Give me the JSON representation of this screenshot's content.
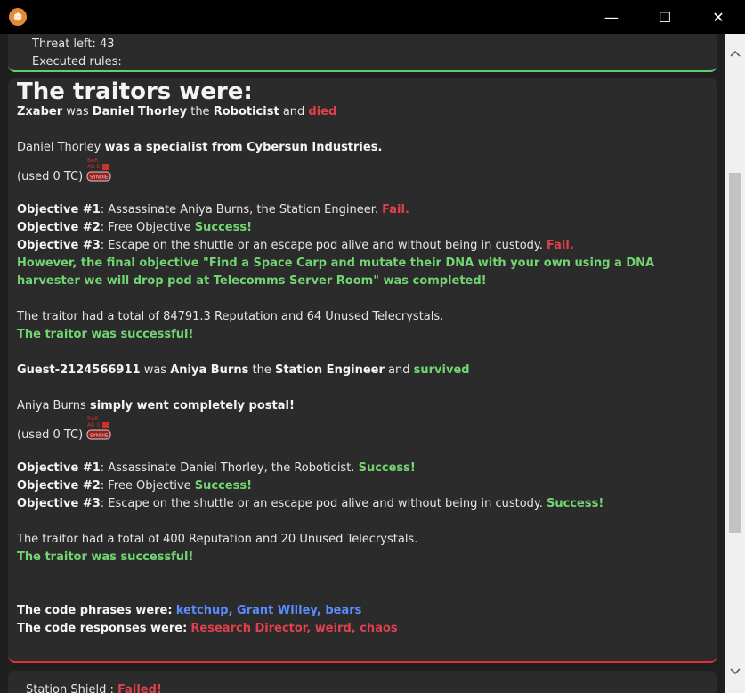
{
  "window": {
    "icon": "app-icon",
    "minimize": "—",
    "maximize": "☐",
    "close": "✕"
  },
  "top_panel": {
    "threat_left": "Threat left: 43",
    "executed_rules": "Executed rules:"
  },
  "heading": "The traitors were:",
  "traitors": [
    {
      "player": "Zxaber",
      "was": "was",
      "name": "Daniel Thorley",
      "the": "the",
      "role": "Roboticist",
      "and": "and",
      "status": "died",
      "origin_name": "Daniel Thorley",
      "origin_text": "was a specialist from Cybersun Industries.",
      "used_tc": "(used 0 TC)",
      "objectives": [
        {
          "label": "Objective #1",
          "text": ": Assassinate Aniya Burns, the Station Engineer.",
          "result": "Fail."
        },
        {
          "label": "Objective #2",
          "text": ": Free Objective",
          "result": "Success!"
        },
        {
          "label": "Objective #3",
          "text": ": Escape on the shuttle or an escape pod alive and without being in custody.",
          "result": "Fail."
        }
      ],
      "final_objective": "However, the final objective \"Find a Space Carp and mutate their DNA with your own using a DNA harvester we will drop pod at Telecomms Server Room\" was completed!",
      "summary": "The traitor had a total of 84791.3 Reputation and 64 Unused Telecrystals.",
      "outcome": "The traitor was successful!"
    },
    {
      "player": "Guest-2124566911",
      "was": "was",
      "name": "Aniya Burns",
      "the": "the",
      "role": "Station Engineer",
      "and": "and",
      "status": "survived",
      "origin_name": "Aniya Burns",
      "origin_text": "simply went completely postal!",
      "used_tc": "(used 0 TC)",
      "objectives": [
        {
          "label": "Objective #1",
          "text": ": Assassinate Daniel Thorley, the Roboticist.",
          "result": "Success!"
        },
        {
          "label": "Objective #2",
          "text": ": Free Objective",
          "result": "Success!"
        },
        {
          "label": "Objective #3",
          "text": ": Escape on the shuttle or an escape pod alive and without being in custody.",
          "result": "Success!"
        }
      ],
      "summary": "The traitor had a total of 400 Reputation and 20 Unused Telecrystals.",
      "outcome": "The traitor was successful!"
    }
  ],
  "uplink_icon_text": {
    "top": "BAR",
    "mid": "AG S",
    "badge": "SYNDIE"
  },
  "code_phrases": {
    "label": "The code phrases were:",
    "value": "ketchup, Grant Willey, bears"
  },
  "code_responses": {
    "label": "The code responses were:",
    "value": "Research Director, weird, chaos"
  },
  "bottom_panel": {
    "label": "Station Shield :",
    "value": "Failed!"
  },
  "colors": {
    "fail": "#e0404b",
    "success": "#72d572",
    "phrase": "#5b8cff",
    "divider_green": "#5fcf6e",
    "divider_red": "#e0303a"
  }
}
